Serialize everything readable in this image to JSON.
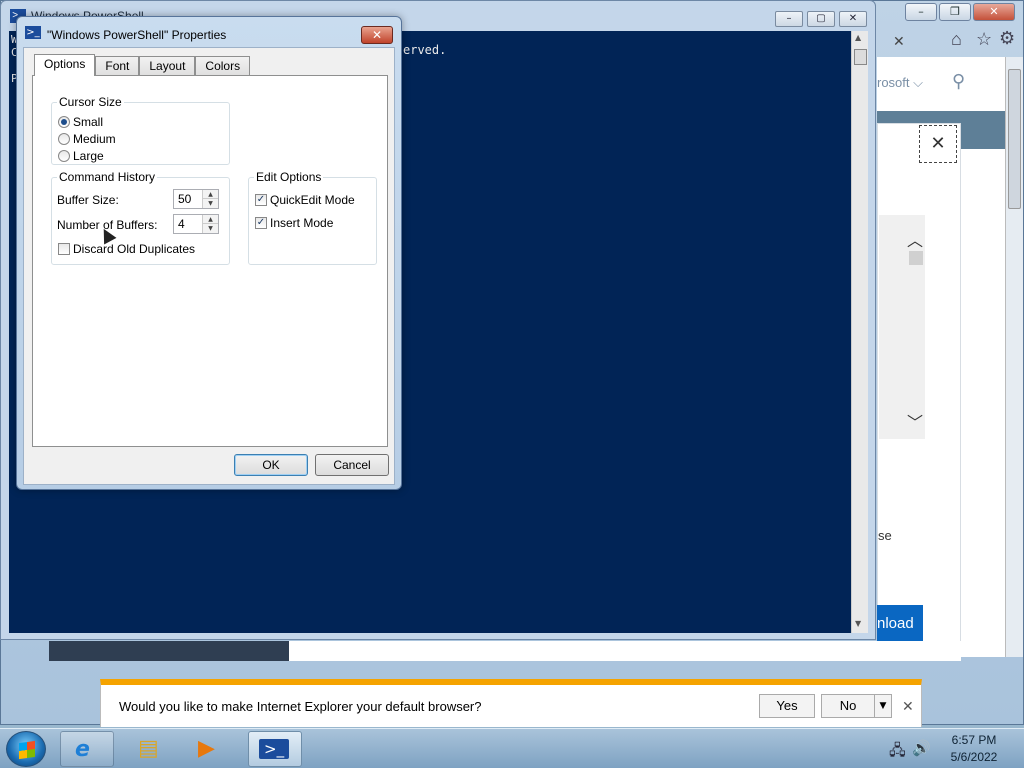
{
  "ie": {
    "caption": {
      "minimize": "–",
      "maximize": "❐",
      "close": "✕"
    },
    "tab_close": "✕",
    "home_icon": "⌂",
    "favorites_icon": "☆",
    "tools_icon": "⚙",
    "nav_fragment": "rosoft ⌵",
    "search_icon": "⚲",
    "modal_close": "✕",
    "scroll_up": "︿",
    "scroll_down": "﹀",
    "body_fragment": "se",
    "download_fragment": "nload"
  },
  "powershell": {
    "title": "Windows PowerShell",
    "icon_glyph": ">_",
    "caption": {
      "minimize": "–",
      "maximize": "▢",
      "close": "✕"
    },
    "console_left": "W\nC\n\nP",
    "console_fragment": "erved.",
    "scroll_up": "▲",
    "scroll_down": "▼"
  },
  "dialog": {
    "title": "\"Windows PowerShell\" Properties",
    "icon_glyph": ">_",
    "close_glyph": "✕",
    "tabs": [
      {
        "label": "Options",
        "active": true
      },
      {
        "label": "Font",
        "active": false
      },
      {
        "label": "Layout",
        "active": false
      },
      {
        "label": "Colors",
        "active": false
      }
    ],
    "cursor_size": {
      "legend": "Cursor Size",
      "options": [
        {
          "label": "Small",
          "selected": true
        },
        {
          "label": "Medium",
          "selected": false
        },
        {
          "label": "Large",
          "selected": false
        }
      ]
    },
    "command_history": {
      "legend": "Command History",
      "buffer_size_label": "Buffer Size:",
      "buffer_size_value": "50",
      "num_buffers_label": "Number of Buffers:",
      "num_buffers_value": "4",
      "discard_label": "Discard Old Duplicates",
      "discard_checked": false
    },
    "edit_options": {
      "legend": "Edit Options",
      "quickedit_label": "QuickEdit Mode",
      "quickedit_checked": true,
      "insert_label": "Insert Mode",
      "insert_checked": true
    },
    "spin_up": "▲",
    "spin_down": "▼",
    "ok_label": "OK",
    "cancel_label": "Cancel"
  },
  "notification": {
    "message": "Would you like to make Internet Explorer your default browser?",
    "yes_label": "Yes",
    "no_label": "No",
    "dropdown_glyph": "▼",
    "close_glyph": "✕"
  },
  "taskbar": {
    "items": [
      {
        "name": "internet-explorer",
        "glyph": "e",
        "color": "#1e7fd6"
      },
      {
        "name": "file-explorer",
        "glyph": "▤",
        "color": "#d9a62a"
      },
      {
        "name": "media-player",
        "glyph": "▶",
        "color": "#e7780d"
      },
      {
        "name": "powershell",
        "glyph": ">_",
        "color": "#1b4c9c"
      }
    ],
    "network_icon": "🖧",
    "volume_icon": "🔊",
    "time": "6:57 PM",
    "date": "5/6/2022"
  },
  "colors": {
    "console_background": "#012456",
    "notification_accent": "#f5a300",
    "download_button": "#0a67c2"
  }
}
